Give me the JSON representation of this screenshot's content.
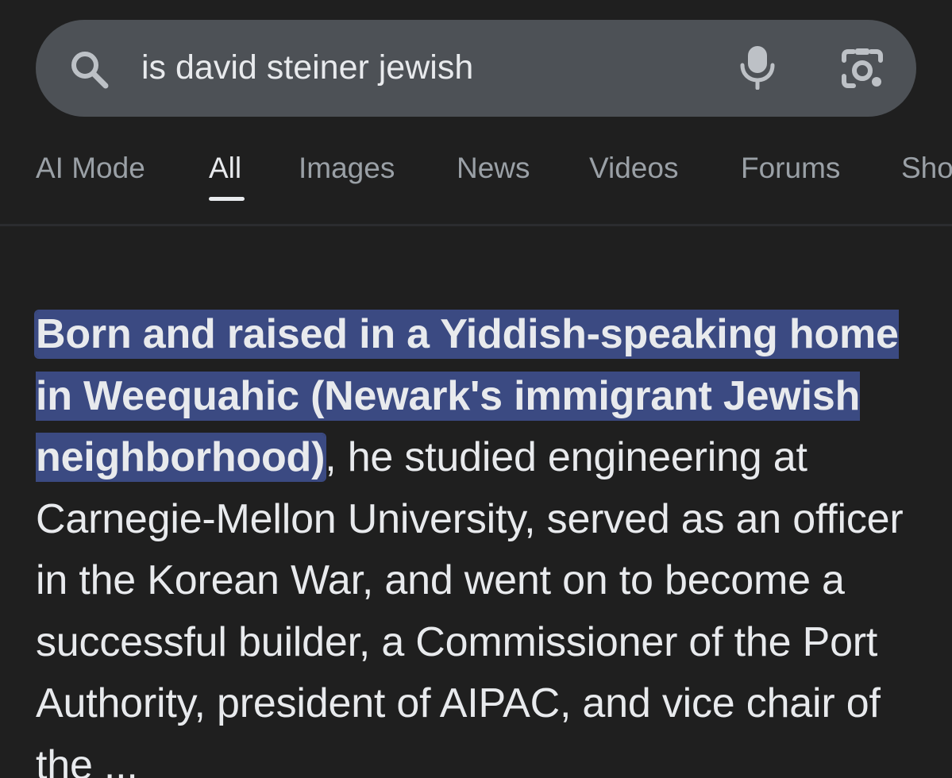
{
  "search": {
    "query": "is david steiner jewish",
    "search_icon": "search-icon",
    "mic_icon": "microphone-icon",
    "lens_icon": "camera-lens-icon"
  },
  "tabs": [
    {
      "label": "AI Mode",
      "active": false
    },
    {
      "label": "All",
      "active": true
    },
    {
      "label": "Images",
      "active": false
    },
    {
      "label": "News",
      "active": false
    },
    {
      "label": "Videos",
      "active": false
    },
    {
      "label": "Forums",
      "active": false
    },
    {
      "label": "Sho",
      "active": false
    }
  ],
  "answer": {
    "highlighted_text": " Born and raised in a Yiddish-speaking home in Weequahic (Newark's immigrant Jewish neighborhood)",
    "body_text": ", he studied engineering at Carnegie-Mellon University, served as an officer in the Korean War, and went on to become a successful builder, a Commissioner of the Port Authority, president of AIPAC, and vice chair of the ..."
  },
  "colors": {
    "background": "#1f1f1f",
    "search_bar": "#4d5156",
    "highlight": "#3b4a82",
    "text": "#e8eaed",
    "muted_text": "#9aa0a6"
  }
}
